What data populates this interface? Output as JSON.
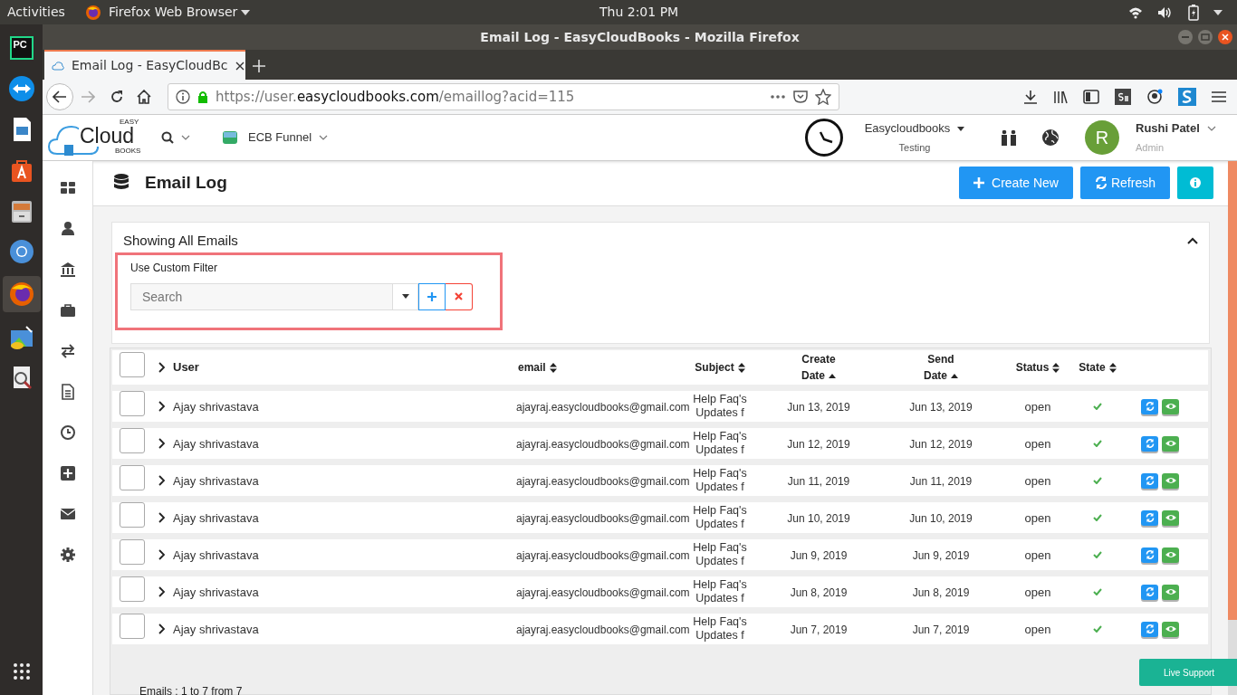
{
  "top_bar": {
    "activities": "Activities",
    "app_menu": "Firefox Web Browser",
    "clock": "Thu  2:01 PM"
  },
  "dock": {
    "pycharm_label": "PC"
  },
  "window": {
    "title": "Email Log - EasyCloudBooks - Mozilla Firefox"
  },
  "tabs": [
    {
      "label": "Email Log - EasyCloudBc",
      "selected": true
    }
  ],
  "address_bar": {
    "url_prefix": "https://user.",
    "url_domain": "easycloudbooks.com",
    "url_path": "/emaillog?acid=115"
  },
  "app_header": {
    "logo_easy": "EASY",
    "logo_cloud": "Cloud",
    "logo_books": "BOOKS",
    "funnel": "ECB Funnel",
    "company": "Easycloudbooks",
    "company_sub": "Testing",
    "avatar": "R",
    "user_name": "Rushi Patel",
    "user_role": "Admin"
  },
  "page": {
    "title": "Email Log",
    "buttons": [
      "Create New",
      "Refresh"
    ]
  },
  "card": {
    "title": "Showing All Emails",
    "filter_label": "Use Custom Filter",
    "search": {
      "placeholder": "Search"
    }
  },
  "table": {
    "columns": [
      {
        "label": "User",
        "sortable": false,
        "sorted": false
      },
      {
        "label": "email",
        "sortable": true,
        "sorted": false
      },
      {
        "label": "Subject",
        "sortable": true,
        "sorted": false
      },
      {
        "label": "Create Date",
        "sortable": true,
        "sorted": true
      },
      {
        "label": "Send Date",
        "sortable": true,
        "sorted": true
      },
      {
        "label": "Status",
        "sortable": true,
        "sorted": false
      },
      {
        "label": "State",
        "sortable": true,
        "sorted": false
      }
    ],
    "header_checked": false,
    "rows": [
      {
        "checked": false,
        "user": "Ajay shrivastava",
        "email": "ajayraj.easycloudbooks@gmail.com",
        "subject": "Help Faq's Updates f",
        "create_date": "Jun 13, 2019",
        "send_date": "Jun 13, 2019",
        "status": "open",
        "state_ok": true
      },
      {
        "checked": false,
        "user": "Ajay shrivastava",
        "email": "ajayraj.easycloudbooks@gmail.com",
        "subject": "Help Faq's Updates f",
        "create_date": "Jun 12, 2019",
        "send_date": "Jun 12, 2019",
        "status": "open",
        "state_ok": true
      },
      {
        "checked": false,
        "user": "Ajay shrivastava",
        "email": "ajayraj.easycloudbooks@gmail.com",
        "subject": "Help Faq's Updates f",
        "create_date": "Jun 11, 2019",
        "send_date": "Jun 11, 2019",
        "status": "open",
        "state_ok": true
      },
      {
        "checked": false,
        "user": "Ajay shrivastava",
        "email": "ajayraj.easycloudbooks@gmail.com",
        "subject": "Help Faq's Updates f",
        "create_date": "Jun 10, 2019",
        "send_date": "Jun 10, 2019",
        "status": "open",
        "state_ok": true
      },
      {
        "checked": false,
        "user": "Ajay shrivastava",
        "email": "ajayraj.easycloudbooks@gmail.com",
        "subject": "Help Faq's Updates f",
        "create_date": "Jun 9, 2019",
        "send_date": "Jun 9, 2019",
        "status": "open",
        "state_ok": true
      },
      {
        "checked": false,
        "user": "Ajay shrivastava",
        "email": "ajayraj.easycloudbooks@gmail.com",
        "subject": "Help Faq's Updates f",
        "create_date": "Jun 8, 2019",
        "send_date": "Jun 8, 2019",
        "status": "open",
        "state_ok": true
      },
      {
        "checked": false,
        "user": "Ajay shrivastava",
        "email": "ajayraj.easycloudbooks@gmail.com",
        "subject": "Help Faq's Updates f",
        "create_date": "Jun 7, 2019",
        "send_date": "Jun 7, 2019",
        "status": "open",
        "state_ok": true
      }
    ]
  },
  "footer": {
    "summary": "Emails : 1 to 7 from 7",
    "live_support": "Live Support"
  }
}
